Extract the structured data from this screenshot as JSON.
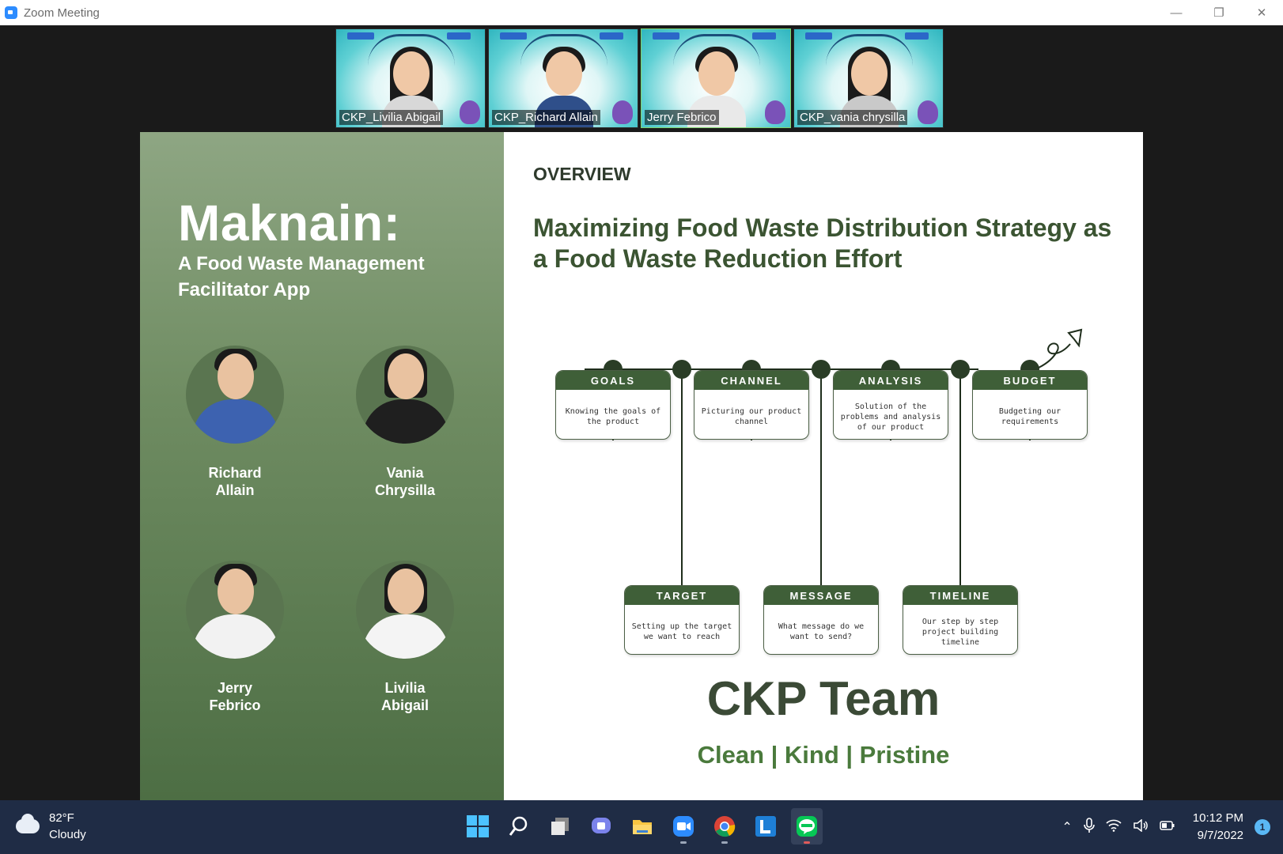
{
  "window": {
    "title": "Zoom Meeting",
    "minimize": "—",
    "restore": "❐",
    "close": "✕"
  },
  "participants": [
    {
      "name": "CKP_Livilia Abigail",
      "active": false
    },
    {
      "name": "CKP_Richard Allain",
      "active": false
    },
    {
      "name": "Jerry Febrico",
      "active": true
    },
    {
      "name": "CKP_vania chrysilla",
      "active": false
    }
  ],
  "slide": {
    "brand": "Maknain:",
    "subtitle": "A Food Waste Management Facilitator App",
    "members": [
      {
        "first": "Richard",
        "last": "Allain"
      },
      {
        "first": "Vania",
        "last": "Chrysilla"
      },
      {
        "first": "Jerry",
        "last": "Febrico"
      },
      {
        "first": "Livilia",
        "last": "Abigail"
      }
    ],
    "overview": "OVERVIEW",
    "headline": "Maximizing Food Waste Distribution Strategy as a Food Waste Reduction Effort",
    "steps_top": [
      {
        "title": "GOALS",
        "text": "Knowing the goals of the product"
      },
      {
        "title": "CHANNEL",
        "text": "Picturing our product channel"
      },
      {
        "title": "ANALYSIS",
        "text": "Solution of the problems and analysis of our product"
      },
      {
        "title": "BUDGET",
        "text": "Budgeting our requirements"
      }
    ],
    "steps_bottom": [
      {
        "title": "TARGET",
        "text": "Setting up the target we want to reach"
      },
      {
        "title": "MESSAGE",
        "text": "What message do we want to send?"
      },
      {
        "title": "TIMELINE",
        "text": "Our step by step project building timeline"
      }
    ],
    "team": "CKP Team",
    "tagline": "Clean | Kind | Pristine",
    "colors": {
      "green_dark": "#3f5f38",
      "green_text": "#4a7a3c"
    }
  },
  "taskbar": {
    "temperature": "82°F",
    "condition": "Cloudy",
    "time": "10:12 PM",
    "date": "9/7/2022",
    "notifications": "1",
    "apps": [
      "windows-start",
      "search",
      "task-view",
      "teams-chat",
      "file-explorer",
      "zoom",
      "chrome",
      "l-app",
      "line"
    ]
  }
}
